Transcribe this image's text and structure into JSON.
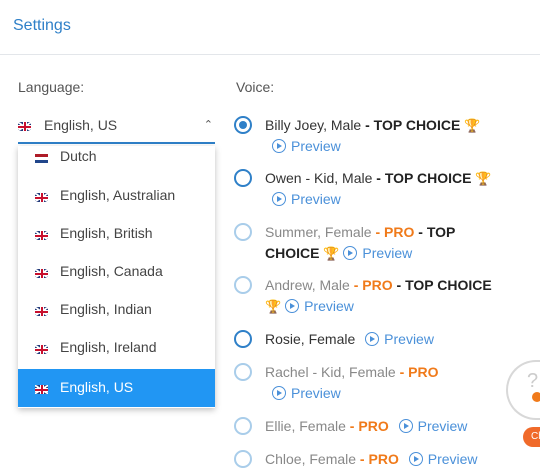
{
  "header": {
    "title": "Settings"
  },
  "language": {
    "label": "Language:",
    "selected": "English, US",
    "options": [
      {
        "label": "Dutch",
        "flag": "nl"
      },
      {
        "label": "English, Australian",
        "flag": "uk"
      },
      {
        "label": "English, British",
        "flag": "uk"
      },
      {
        "label": "English, Canada",
        "flag": "uk"
      },
      {
        "label": "English, Indian",
        "flag": "uk"
      },
      {
        "label": "English, Ireland",
        "flag": "uk"
      },
      {
        "label": "English, US",
        "flag": "uk"
      }
    ]
  },
  "voice": {
    "label": "Voice:",
    "preview_label": "Preview",
    "items": [
      {
        "name": "Billy Joey, Male",
        "dash": " - ",
        "top_choice": "TOP CHOICE"
      },
      {
        "name": "Owen - Kid, Male",
        "dash": " - ",
        "top_choice": "TOP CHOICE"
      },
      {
        "name": "Summer, Female",
        "dash": " - ",
        "pro": "PRO",
        "dash2": " - ",
        "top_choice_1": "TOP",
        "top_choice_2": "CHOICE"
      },
      {
        "name": "Andrew, Male",
        "dash": " - ",
        "pro": "PRO",
        "dash2": " - ",
        "top_choice": "TOP CHOICE"
      },
      {
        "name": "Rosie, Female"
      },
      {
        "name": "Rachel - Kid, Female",
        "dash": " - ",
        "pro": "PRO"
      },
      {
        "name": "Ellie, Female",
        "dash": " - ",
        "pro": "PRO"
      },
      {
        "name": "Chloe, Female",
        "dash": " - ",
        "pro": "PRO"
      }
    ]
  },
  "colors": {
    "accent": "#2f80c8",
    "selected_bg": "#2196f3",
    "pro": "#f07a1a"
  },
  "icons": {
    "trophy": "🏆",
    "chevron": "⌃",
    "help_badge": "Ch"
  }
}
